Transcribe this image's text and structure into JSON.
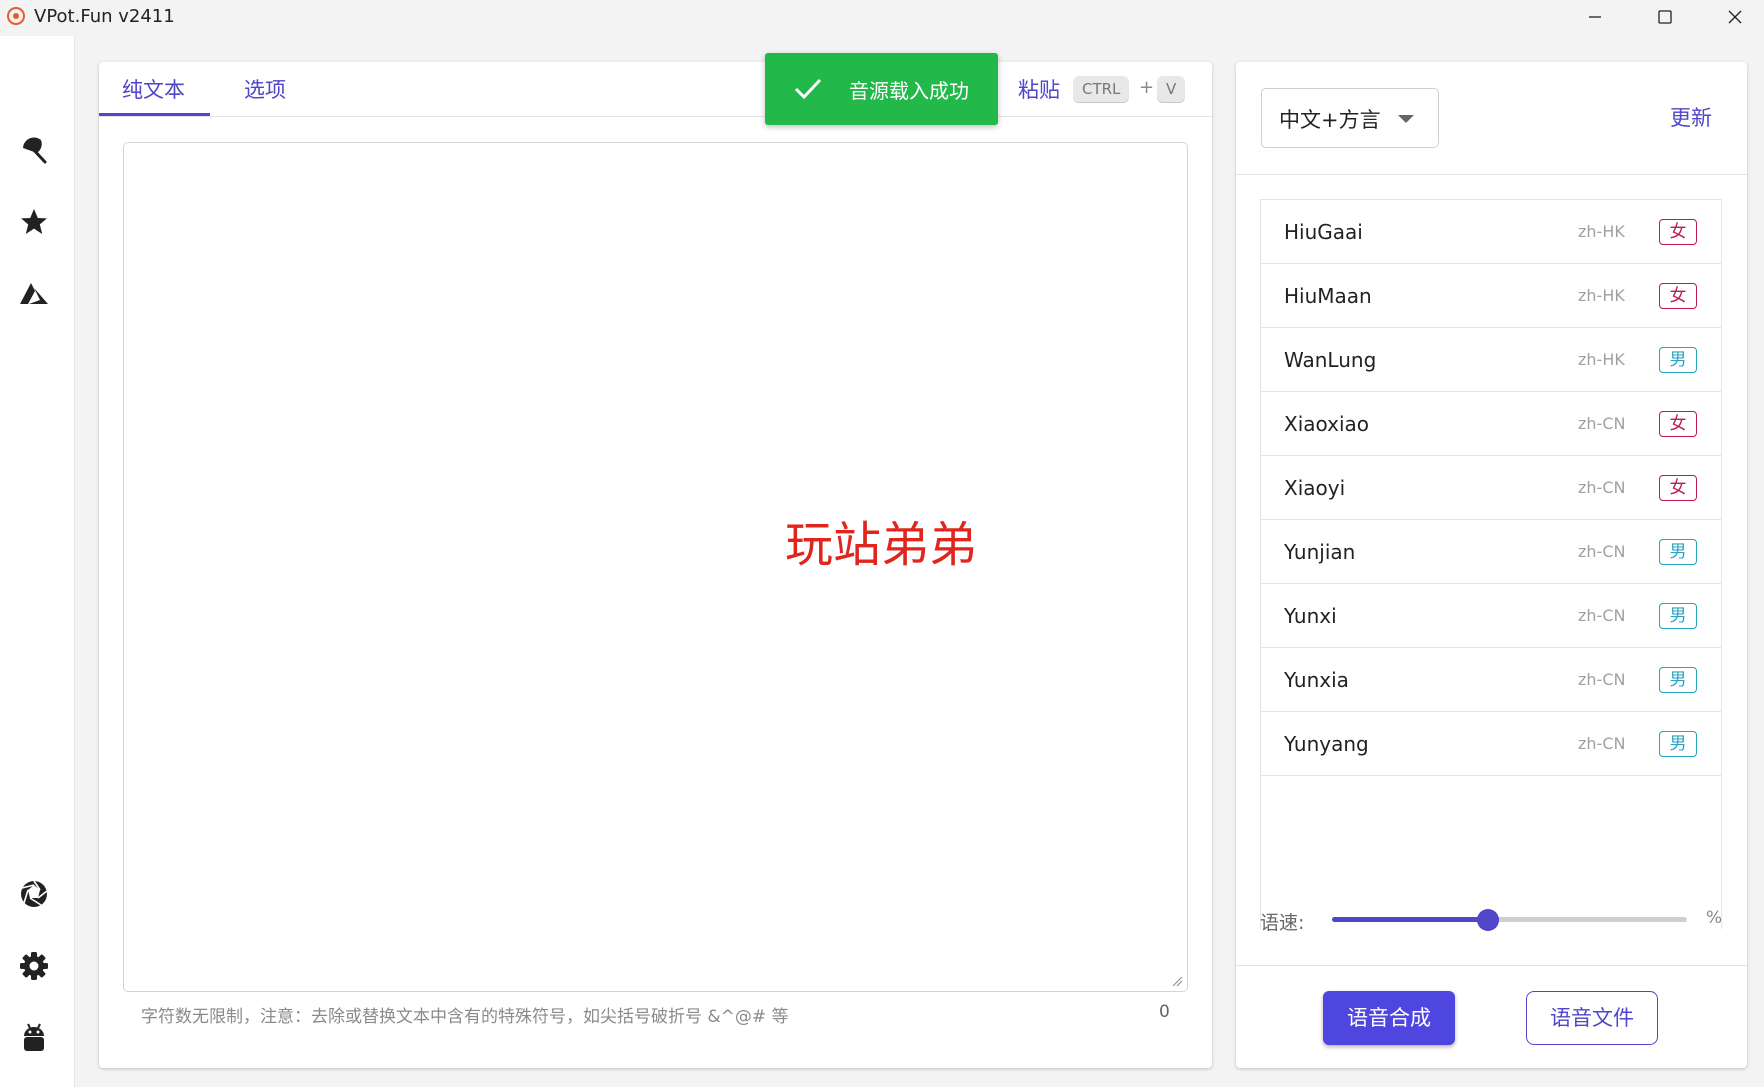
{
  "window": {
    "title": "VPot.Fun v2411"
  },
  "tabs": {
    "plain_text": "纯文本",
    "options": "选项"
  },
  "paste": {
    "label": "粘贴",
    "ctrl_key": "CTRL",
    "plus": "+",
    "v_key": "V"
  },
  "toast": {
    "message": "音源载入成功",
    "color": "#22b84a"
  },
  "watermark": "玩站弟弟",
  "editor": {
    "value": "",
    "hint": "字符数无限制，注意：去除或替换文本中含有的特殊符号，如尖括号破折号 &^@# 等",
    "char_count": "0"
  },
  "right_panel": {
    "language_select": "中文+方言",
    "update_label": "更新",
    "voices": [
      {
        "name": "HiuGaai",
        "locale": "zh-HK",
        "gender": "女",
        "gender_type": "female"
      },
      {
        "name": "HiuMaan",
        "locale": "zh-HK",
        "gender": "女",
        "gender_type": "female"
      },
      {
        "name": "WanLung",
        "locale": "zh-HK",
        "gender": "男",
        "gender_type": "male"
      },
      {
        "name": "Xiaoxiao",
        "locale": "zh-CN",
        "gender": "女",
        "gender_type": "female"
      },
      {
        "name": "Xiaoyi",
        "locale": "zh-CN",
        "gender": "女",
        "gender_type": "female"
      },
      {
        "name": "Yunjian",
        "locale": "zh-CN",
        "gender": "男",
        "gender_type": "male"
      },
      {
        "name": "Yunxi",
        "locale": "zh-CN",
        "gender": "男",
        "gender_type": "male"
      },
      {
        "name": "Yunxia",
        "locale": "zh-CN",
        "gender": "男",
        "gender_type": "male"
      },
      {
        "name": "Yunyang",
        "locale": "zh-CN",
        "gender": "男",
        "gender_type": "male"
      }
    ],
    "speed_label": "语速:",
    "speed_unit": "%",
    "speed_fraction": 0.44,
    "synth_button": "语音合成",
    "file_button": "语音文件"
  },
  "nav_icons": [
    "umbrella-icon",
    "star-icon",
    "azure-icon",
    "aperture-icon",
    "settings-icon",
    "android-icon"
  ],
  "colors": {
    "accent": "#4f46c8",
    "female": "#c2185b",
    "male": "#26a5c0"
  }
}
